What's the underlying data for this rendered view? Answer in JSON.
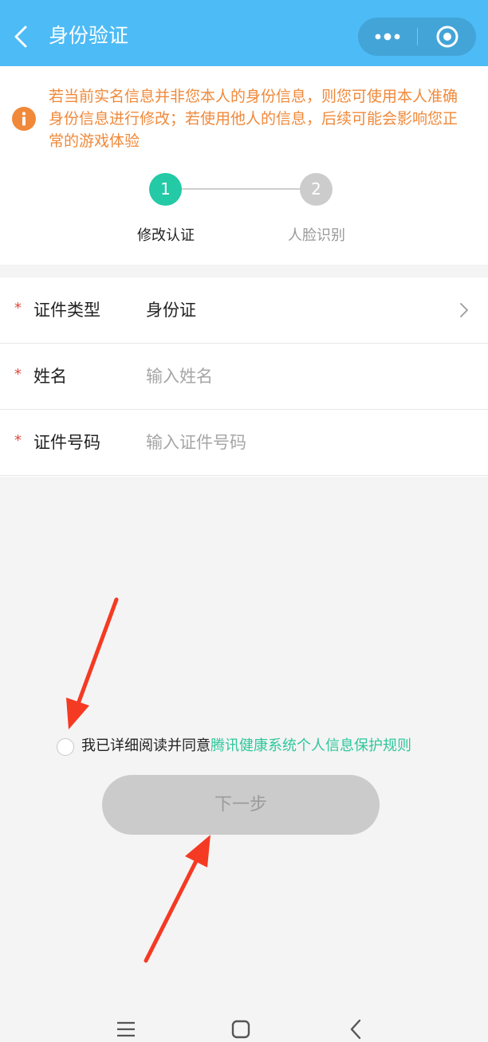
{
  "colors": {
    "header_bg": "#4dbbf6",
    "accent_green": "#24c9a6",
    "link_green": "#2fc79c",
    "notice_orange": "#f0893a",
    "required_red": "#e04a3c",
    "annotation_arrow": "#f53a23",
    "disabled_button": "#cbcbcb"
  },
  "header": {
    "title": "身份验证",
    "back_icon": "chevron-left-icon",
    "more_icon": "more-dots-icon",
    "close_icon": "target-circle-icon"
  },
  "notice": {
    "icon": "info-icon",
    "text": "若当前实名信息并非您本人的身份信息，则您可使用本人准确身份信息进行修改；若使用他人的信息，后续可能会影响您正常的游戏体验"
  },
  "steps": [
    {
      "number": "1",
      "label": "修改认证",
      "active": true
    },
    {
      "number": "2",
      "label": "人脸识别",
      "active": false
    }
  ],
  "form": {
    "required_mark": "*",
    "id_type": {
      "label": "证件类型",
      "value": "身份证"
    },
    "name": {
      "label": "姓名",
      "placeholder": "输入姓名"
    },
    "id_number": {
      "label": "证件号码",
      "placeholder": "输入证件号码"
    }
  },
  "agreement": {
    "checked": false,
    "prefix": "我已详细阅读并同意",
    "link": "腾讯健康系统个人信息保护规则"
  },
  "next_button": {
    "label": "下一步",
    "enabled": false
  },
  "system_nav": {
    "menu_icon": "menu-icon",
    "home_icon": "home-square-icon",
    "back_icon": "back-triangle-icon"
  }
}
